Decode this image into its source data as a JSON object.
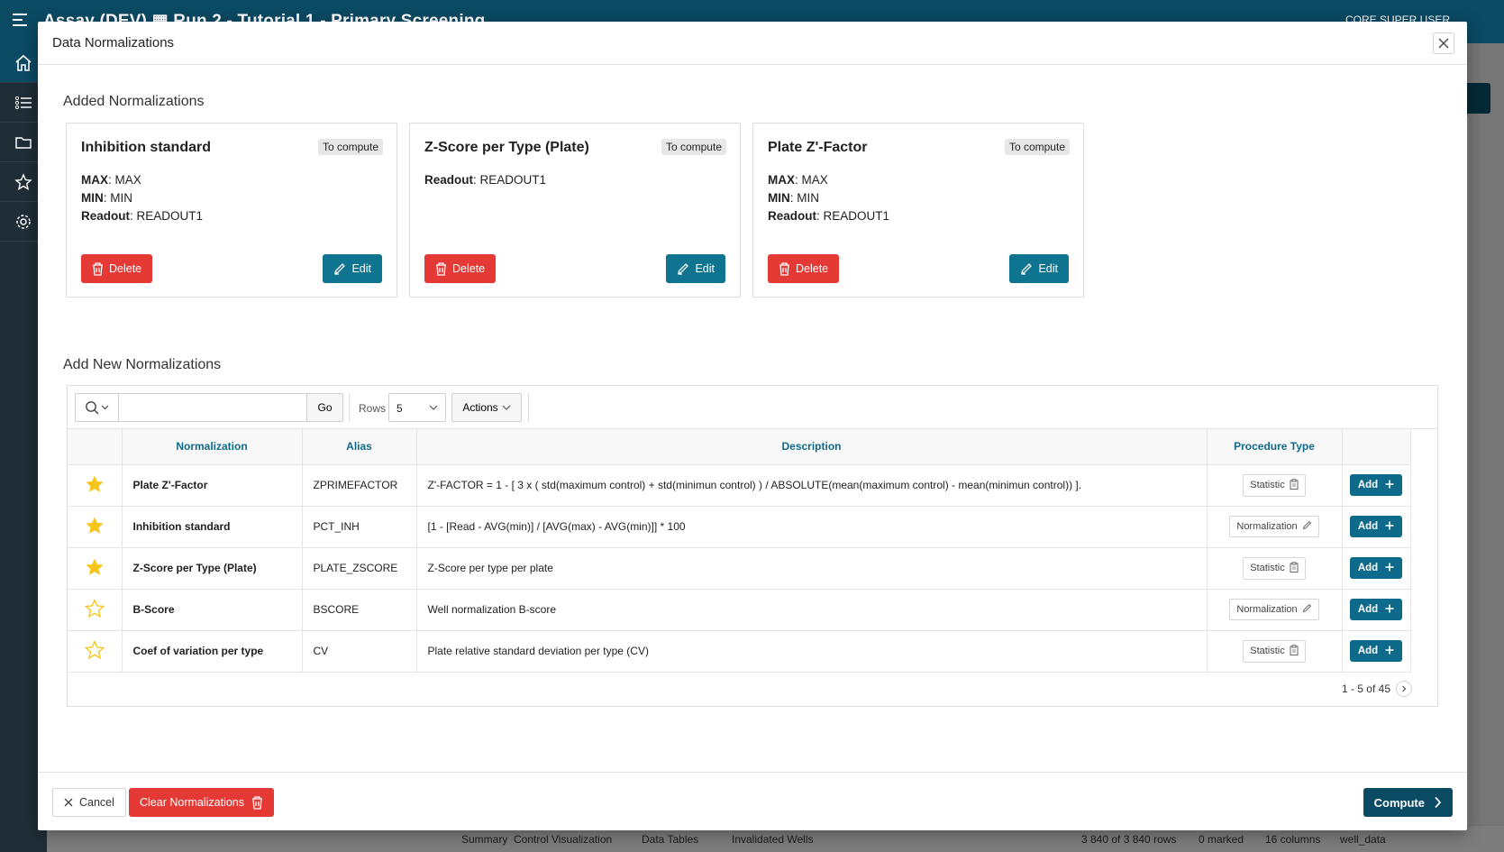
{
  "app": {
    "title": "Assay (DEV) ▦  Run 2 - Tutorial 1 - Primary Screening",
    "user": "CORE SUPER USER"
  },
  "bottom_bar": {
    "tabs": [
      "Summary",
      "Control Visualization",
      "Data Tables",
      "Invalidated Wells"
    ],
    "rows": "3 840 of 3 840 rows",
    "marked": "0 marked",
    "columns": "16 columns",
    "table": "well_data"
  },
  "modal": {
    "title": "Data Normalizations",
    "added_title": "Added Normalizations",
    "new_title": "Add New Normalizations"
  },
  "added": [
    {
      "title": "Inhibition standard",
      "badge": "To compute",
      "params": [
        {
          "key": "MAX",
          "value": "MAX"
        },
        {
          "key": "MIN",
          "value": "MIN"
        },
        {
          "key": "Readout",
          "value": "READOUT1"
        }
      ],
      "delete_label": "Delete",
      "edit_label": "Edit"
    },
    {
      "title": "Z-Score per Type (Plate)",
      "badge": "To compute",
      "params": [
        {
          "key": "Readout",
          "value": "READOUT1"
        }
      ],
      "delete_label": "Delete",
      "edit_label": "Edit"
    },
    {
      "title": "Plate Z'-Factor",
      "badge": "To compute",
      "params": [
        {
          "key": "MAX",
          "value": "MAX"
        },
        {
          "key": "MIN",
          "value": "MIN"
        },
        {
          "key": "Readout",
          "value": "READOUT1"
        }
      ],
      "delete_label": "Delete",
      "edit_label": "Edit"
    }
  ],
  "toolbar": {
    "search_placeholder": "",
    "go_label": "Go",
    "rows_label": "Rows",
    "rows_value": "5",
    "actions_label": "Actions"
  },
  "table": {
    "columns": [
      "",
      "Normalization",
      "Alias",
      "Description",
      "Procedure Type",
      ""
    ],
    "rows": [
      {
        "starred": true,
        "name": "Plate Z'-Factor",
        "alias": "ZPRIMEFACTOR",
        "description": "Z'-FACTOR = 1 - [ 3 x ( std(maximum control) + std(minimun control) ) / ABSOLUTE(mean(maximum control) - mean(minimun control)) ].",
        "type": "Statistic",
        "type_icon": "clipboard-icon",
        "add_label": "Add"
      },
      {
        "starred": true,
        "name": "Inhibition standard",
        "alias": "PCT_INH",
        "description": "[1 - [Read - AVG(min)] / [AVG(max) - AVG(min)]] * 100",
        "type": "Normalization",
        "type_icon": "pencil-icon",
        "add_label": "Add"
      },
      {
        "starred": true,
        "name": "Z-Score per Type (Plate)",
        "alias": "PLATE_ZSCORE",
        "description": "Z-Score per type per plate",
        "type": "Statistic",
        "type_icon": "clipboard-icon",
        "add_label": "Add"
      },
      {
        "starred": false,
        "name": "B-Score",
        "alias": "BSCORE",
        "description": "Well normalization B-score",
        "type": "Normalization",
        "type_icon": "pencil-icon",
        "add_label": "Add"
      },
      {
        "starred": false,
        "name": "Coef of variation per type",
        "alias": "CV",
        "description": "Plate relative standard deviation per type (CV)",
        "type": "Statistic",
        "type_icon": "clipboard-icon",
        "add_label": "Add"
      }
    ],
    "pagination": "1 - 5 of 45"
  },
  "footer": {
    "cancel_label": "Cancel",
    "clear_label": "Clear Normalizations",
    "compute_label": "Compute"
  },
  "colors": {
    "primary": "#0b4a63",
    "accent": "#0e7490",
    "danger": "#e53935",
    "star": "#f5c518"
  }
}
